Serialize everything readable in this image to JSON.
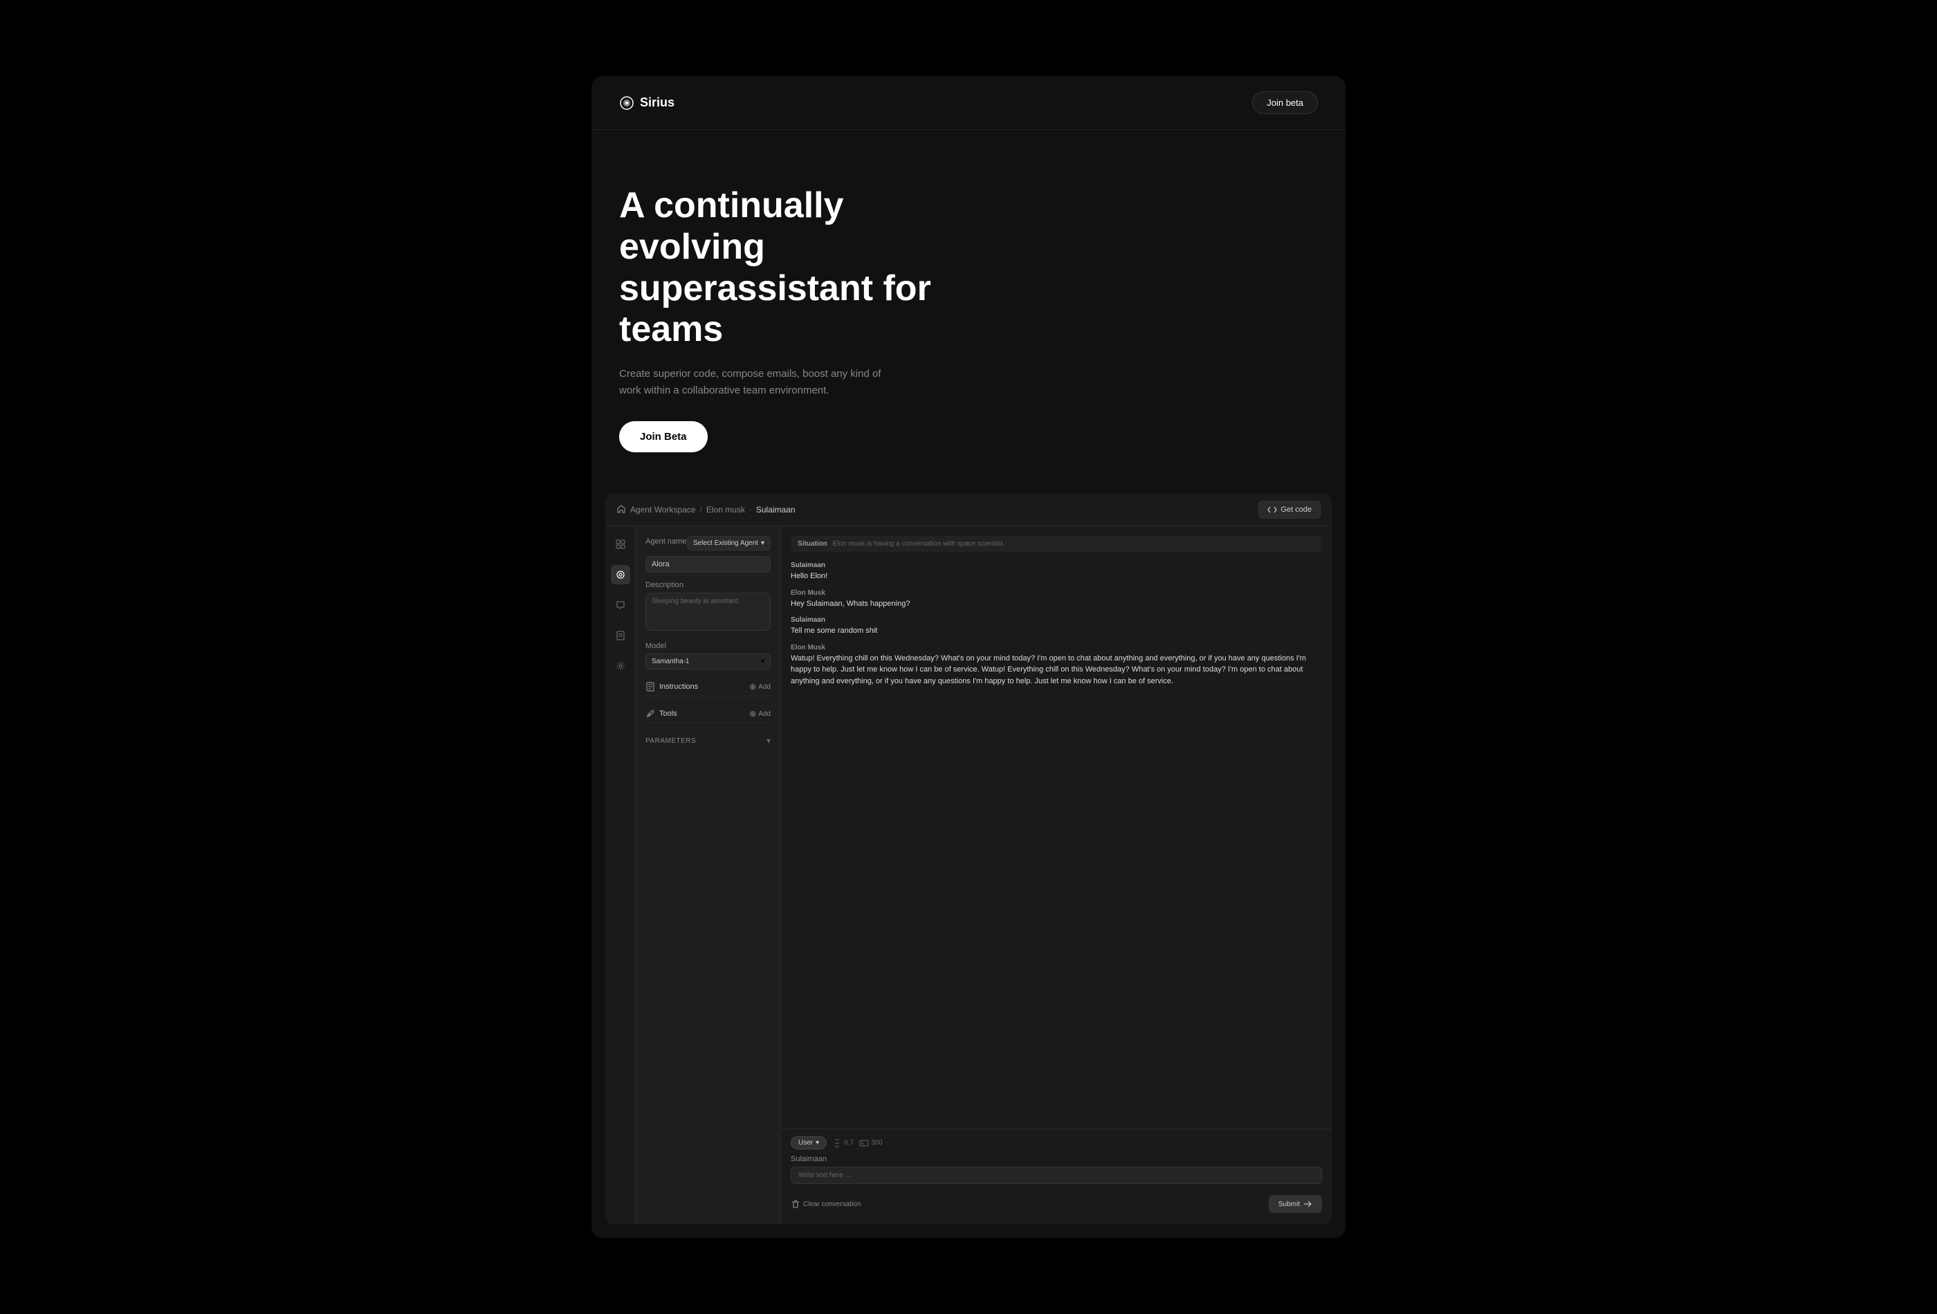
{
  "nav": {
    "logo_text": "Sirius",
    "join_beta_label": "Join beta"
  },
  "hero": {
    "headline_line1": "A continually evolving",
    "headline_line2": "superassistant for teams",
    "subtitle": "Create superior code, compose emails, boost any kind of work within a collaborative team environment.",
    "cta_label": "Join Beta"
  },
  "app": {
    "topbar": {
      "breadcrumb_home": "Agent Workspace",
      "breadcrumb_sep1": "/",
      "breadcrumb_item1": "Elon musk",
      "breadcrumb_sep2": "·",
      "breadcrumb_item2": "Sulaimaan",
      "get_code_label": "Get code"
    },
    "left_panel": {
      "agent_name_label": "Agent name",
      "agent_name_value": "Alora",
      "select_existing_label": "Select Existing Agent",
      "description_label": "Description",
      "description_placeholder": "Sleeping beauty ai assistant.",
      "model_label": "Model",
      "model_value": "Samantha-1",
      "instructions_label": "Instructions",
      "instructions_add": "Add",
      "tools_label": "Tools",
      "tools_add": "Add",
      "parameters_label": "PARAMETERS"
    },
    "chat": {
      "situation_label": "Situation",
      "situation_text": "Elon musk is having a conversation with space scientist.",
      "messages": [
        {
          "author": "Sulaimaan",
          "author_type": "user",
          "text": "Hello Elon!"
        },
        {
          "author": "Elon Musk",
          "author_type": "agent",
          "text": "Hey Sulaimaan, Whats happening?"
        },
        {
          "author": "Sulaimaan",
          "author_type": "user",
          "text": "Tell me some random shit"
        },
        {
          "author": "Elon Musk",
          "author_type": "agent",
          "text": "Watup! Everything chill on this Wednesday? What's on your mind today? I'm open to chat about anything and everything, or if you have any questions I'm happy to help. Just let me know how I can be of service. Watup! Everything chill on this Wednesday? What's on your mind today? I'm open to chat about anything and everything, or if you have any questions I'm happy to help. Just let me know how I can be of service."
        }
      ],
      "user_label": "User",
      "temperature": "0.7",
      "tokens": "300",
      "writer_name": "Sulaimaan",
      "write_placeholder": "Write text here ...",
      "clear_label": "Clear conversation",
      "submit_label": "Submit"
    }
  }
}
